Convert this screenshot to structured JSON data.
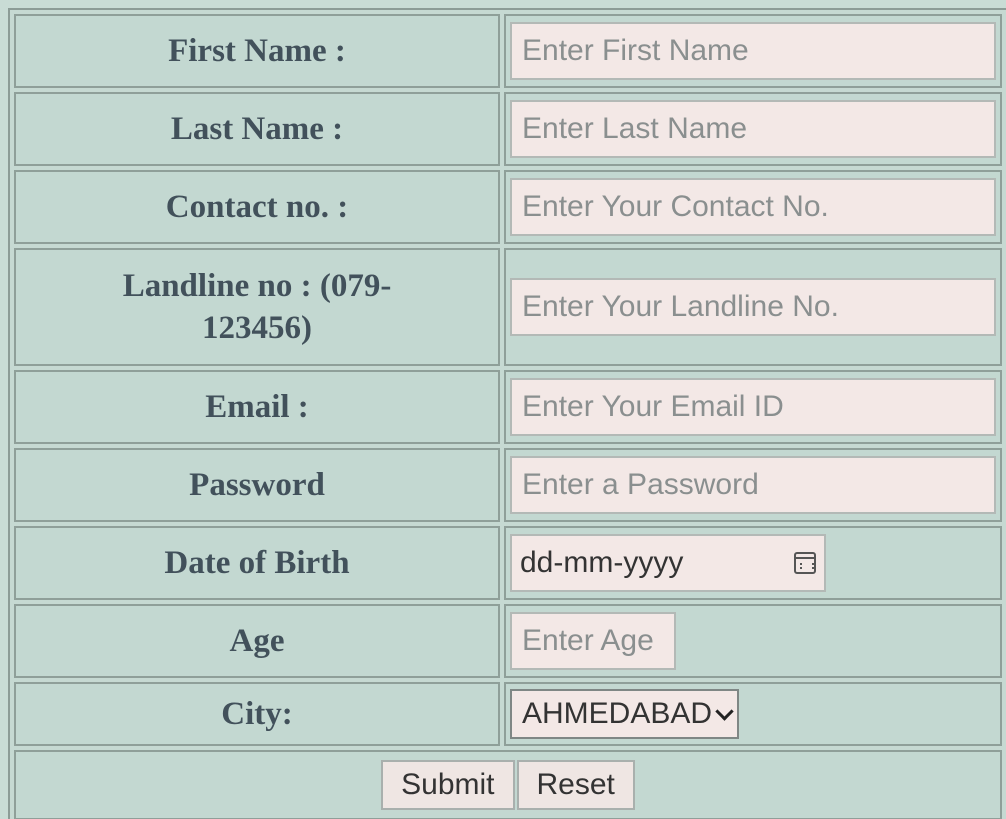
{
  "form": {
    "fields": [
      {
        "label": "First Name :",
        "placeholder": "Enter First Name"
      },
      {
        "label": "Last Name :",
        "placeholder": "Enter Last Name"
      },
      {
        "label": "Contact no. :",
        "placeholder": "Enter Your Contact No."
      },
      {
        "label": "Landline no : (079-123456)",
        "placeholder": "Enter Your Landline No."
      },
      {
        "label": "Email :",
        "placeholder": "Enter Your Email ID"
      },
      {
        "label": "Password",
        "placeholder": "Enter a Password"
      }
    ],
    "dob": {
      "label": "Date of Birth",
      "placeholder": "dd-mm-yyyy"
    },
    "age": {
      "label": "Age",
      "placeholder": "Enter Age"
    },
    "city": {
      "label": "City:",
      "selected": "AHMEDABAD"
    },
    "buttons": {
      "submit": "Submit",
      "reset": "Reset"
    }
  }
}
